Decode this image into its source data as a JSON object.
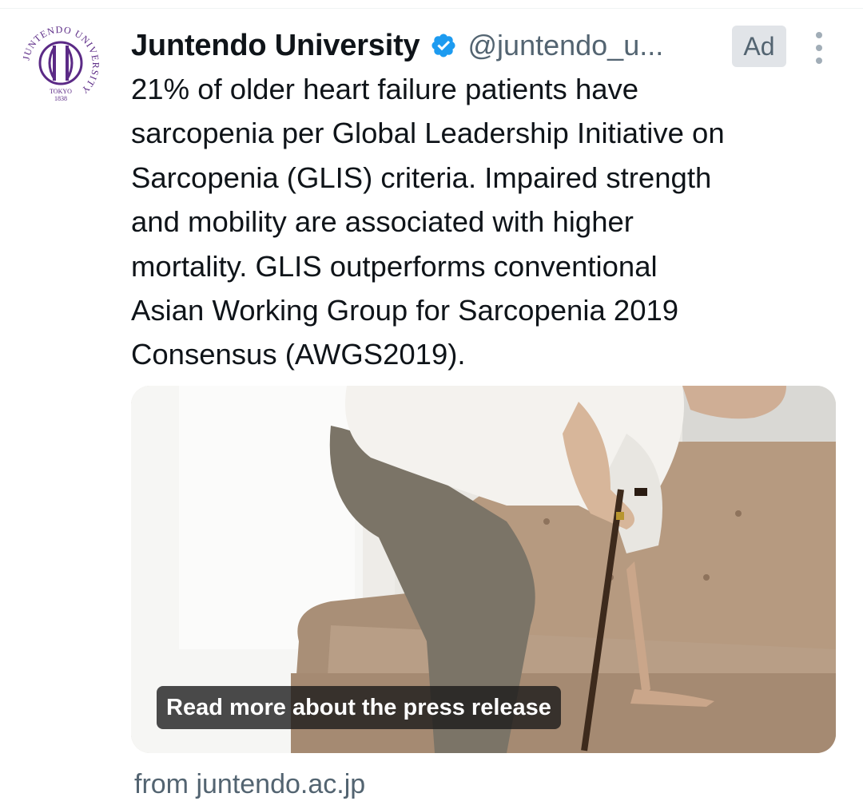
{
  "post": {
    "author_name": "Juntendo University",
    "handle": "@juntendo_u...",
    "ad_label": "Ad",
    "body_text": "21% of older heart failure patients have\nsarcopenia per Global Leadership Initiative on\nSarcopenia (GLIS) criteria. Impaired strength\nand mobility are associated with higher\nmortality. GLIS outperforms conventional\nAsian Working Group for Sarcopenia 2019\nConsensus (AWGS2019).",
    "media": {
      "caption": "Read more about the press release"
    },
    "source": "from juntendo.ac.jp"
  },
  "avatar": {
    "ring_text": "JUNTENDO UNIVERSITY",
    "bottom_text": "TOKYO",
    "year": "1838"
  },
  "icons": {
    "verified": "verified-badge-icon",
    "more": "more-options-icon"
  },
  "colors": {
    "accent": "#1d9bf0",
    "logo_purple": "#5b2a86",
    "secondary_text": "#536471"
  }
}
